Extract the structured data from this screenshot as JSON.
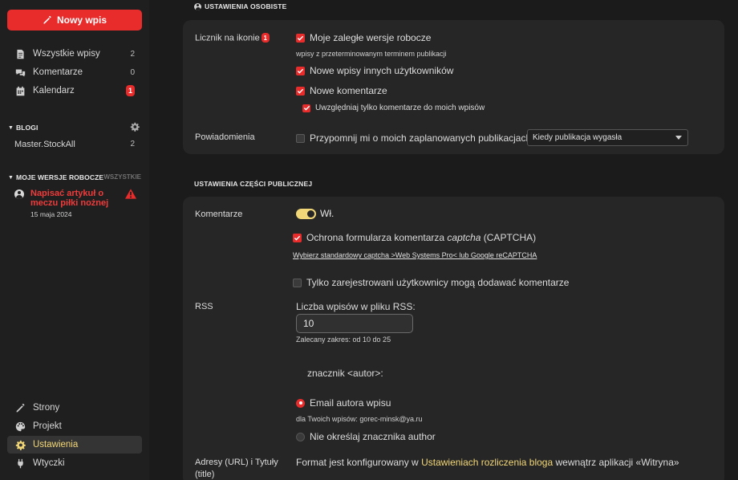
{
  "sidebar": {
    "new_post": "Nowy wpis",
    "nav": [
      {
        "label": "Wszystkie wpisy",
        "count": "2",
        "icon": "document-icon"
      },
      {
        "label": "Komentarze",
        "count": "0",
        "icon": "comments-icon"
      },
      {
        "label": "Kalendarz",
        "count": "1",
        "icon": "calendar-icon"
      }
    ],
    "blogs_header": "BLOGI",
    "blogs": [
      {
        "label": "Master.StockAll",
        "count": "2"
      }
    ],
    "drafts_header": "MOJE WERSJE ROBOCZE",
    "drafts_all": "WSZYSTKIE",
    "draft": {
      "title": "Napisać artykuł o meczu piłki nożnej",
      "date": "15 maja 2024"
    },
    "bottom_nav": [
      {
        "label": "Strony",
        "icon": "pencil-icon"
      },
      {
        "label": "Projekt",
        "icon": "palette-icon"
      },
      {
        "label": "Ustawienia",
        "icon": "gear-icon"
      },
      {
        "label": "Wtyczki",
        "icon": "plug-icon"
      }
    ]
  },
  "personal": {
    "heading": "USTAWIENIA OSOBISTE",
    "counter_label": "Licznik na ikonie",
    "counter_badge": "1",
    "opt_drafts": "Moje zaległe wersje robocze",
    "opt_drafts_hint": "wpisy z przeterminowanym terminem publikacji",
    "opt_others": "Nowe wpisy innych użytkowników",
    "opt_comments": "Nowe komentarze",
    "opt_my_comments": "Uwzględniaj tylko komentarze do moich wpisów",
    "notif_label": "Powiadomienia",
    "notif_remind": "Przypomnij mi o moich zaplanowanych publikacjach",
    "notif_select": "Kiedy publikacja wygasła"
  },
  "public": {
    "heading": "USTAWIENIA CZĘŚCI PUBLICZNEJ",
    "comments_label": "Komentarze",
    "comments_toggle": "Wł.",
    "captcha_pre": "Ochrona formularza komentarza ",
    "captcha_em": "captcha",
    "captcha_post": " (CAPTCHA)",
    "captcha_link": "Wybierz standardowy captcha >Web Systems Pro< lub Google reCAPTCHA",
    "registered_only": "Tylko zarejestrowani użytkownicy mogą dodawać komentarze",
    "rss_label": "RSS",
    "rss_count_label": "Liczba wpisów w pliku RSS:",
    "rss_count_value": "10",
    "rss_hint": "Zalecany zakres: od 10 do 25",
    "author_tag": "znacznik <autor>:",
    "author_email": "Email autora wpisu",
    "author_email_hint": "dla Twoich wpisów: gorec-minsk@ya.ru",
    "author_none": "Nie określaj znacznika author",
    "urls_label_1": "Adresy (URL) i Tytuły",
    "urls_label_2": "(title)",
    "format_pre": "Format jest konfigurowany w ",
    "format_link": "Ustawieniach rozliczenia bloga",
    "format_post": " wewnątrz aplikacji «Witryna»"
  },
  "colors": {
    "accent": "#e82c2c",
    "toggle": "#f2d778"
  }
}
